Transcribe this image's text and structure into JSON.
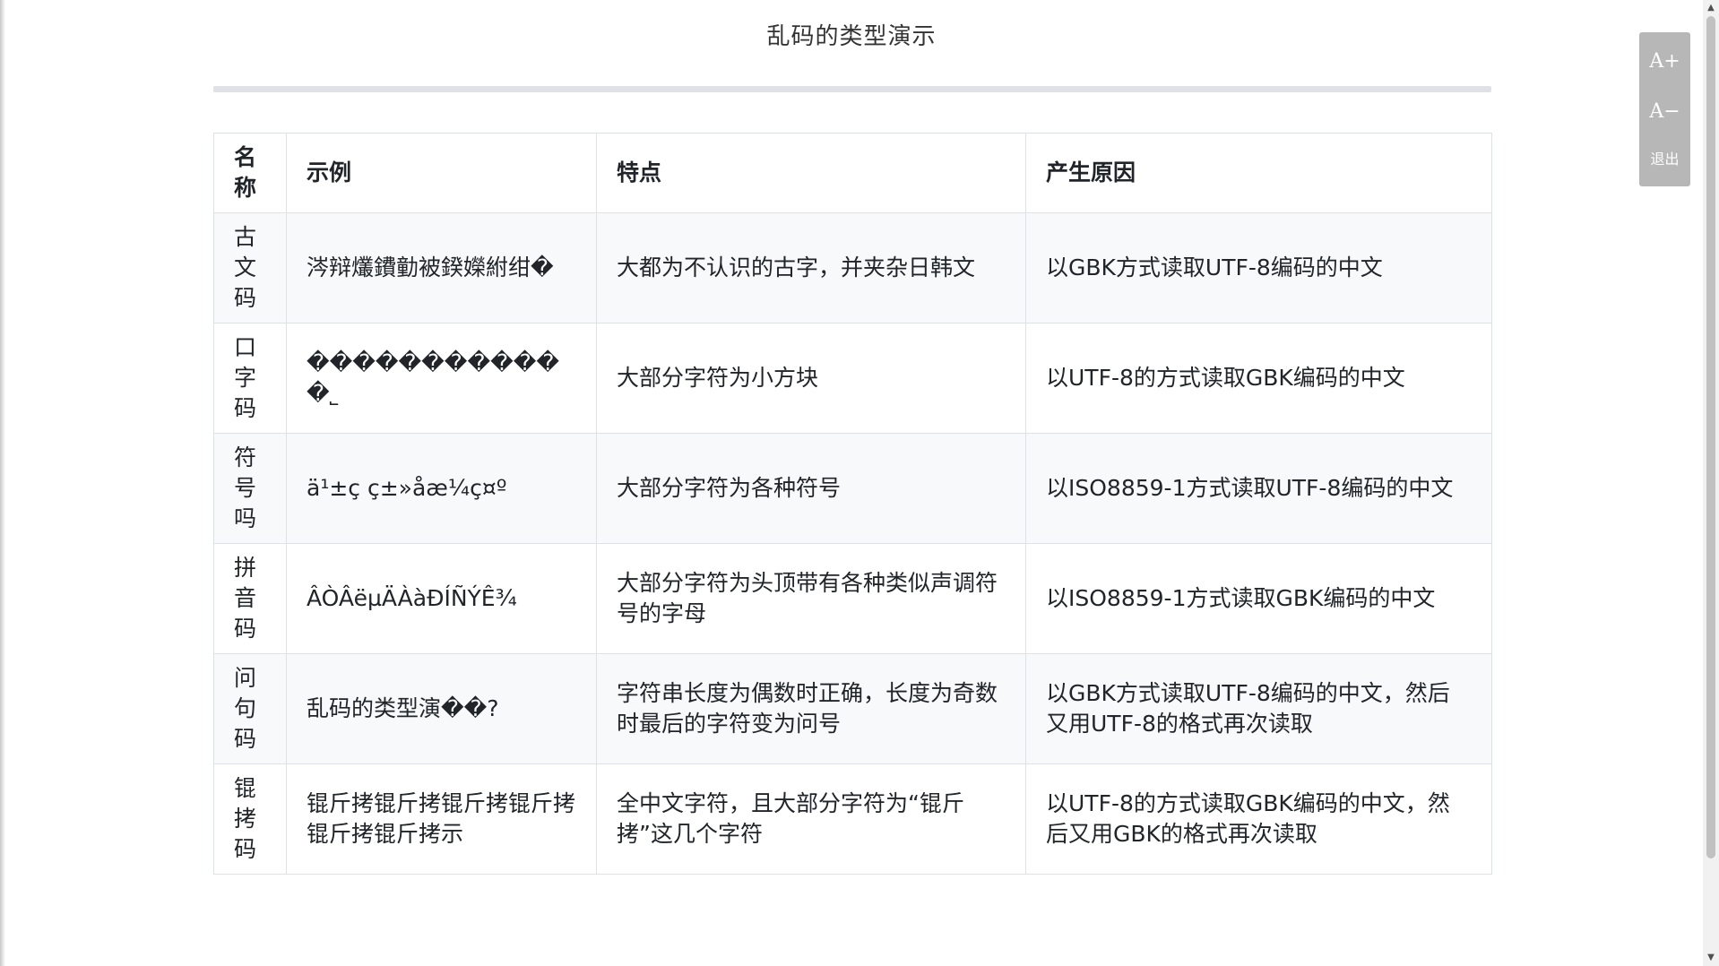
{
  "title": "乱码的类型演示",
  "table": {
    "headers": {
      "name": "名称",
      "example": "示例",
      "feature": "特点",
      "cause": "产生原因"
    },
    "rows": [
      {
        "name": "古文码",
        "example": "涔辩爜鐨勭被鍨嬫紨绀�",
        "feature": "大都为不认识的古字，并夹杂日韩文",
        "cause": "以GBK方式读取UTF-8编码的中文"
      },
      {
        "name": "口字码",
        "example": "������������˾",
        "feature": "大部分字符为小方块",
        "cause": "以UTF-8的方式读取GBK编码的中文"
      },
      {
        "name": "符号吗",
        "example": "ä¹±ç ç±»åæ¼ç¤º",
        "feature": "大部分字符为各种符号",
        "cause": "以ISO8859-1方式读取UTF-8编码的中文"
      },
      {
        "name": "拼音码",
        "example": "ÂÒÂëµÄÀàÐÍÑÝÊ¾",
        "feature": "大部分字符为头顶带有各种类似声调符号的字母",
        "cause": "以ISO8859-1方式读取GBK编码的中文"
      },
      {
        "name": "问句码",
        "example": "乱码的类型演��?",
        "feature": "字符串长度为偶数时正确，长度为奇数时最后的字符变为问号",
        "cause": "以GBK方式读取UTF-8编码的中文，然后又用UTF-8的格式再次读取"
      },
      {
        "name": "锟拷码",
        "example": "锟斤拷锟斤拷锟斤拷锟斤拷锟斤拷锟斤拷示",
        "feature": "全中文字符，且大部分字符为“锟斤拷”这几个字符",
        "cause": "以UTF-8的方式读取GBK编码的中文，然后又用GBK的格式再次读取"
      }
    ]
  },
  "toolbox": {
    "font_increase": "A+",
    "font_decrease": "A−",
    "exit": "退出"
  },
  "icons": {
    "scroll_up": "chevron-up-icon",
    "scroll_down": "chevron-down-icon"
  }
}
